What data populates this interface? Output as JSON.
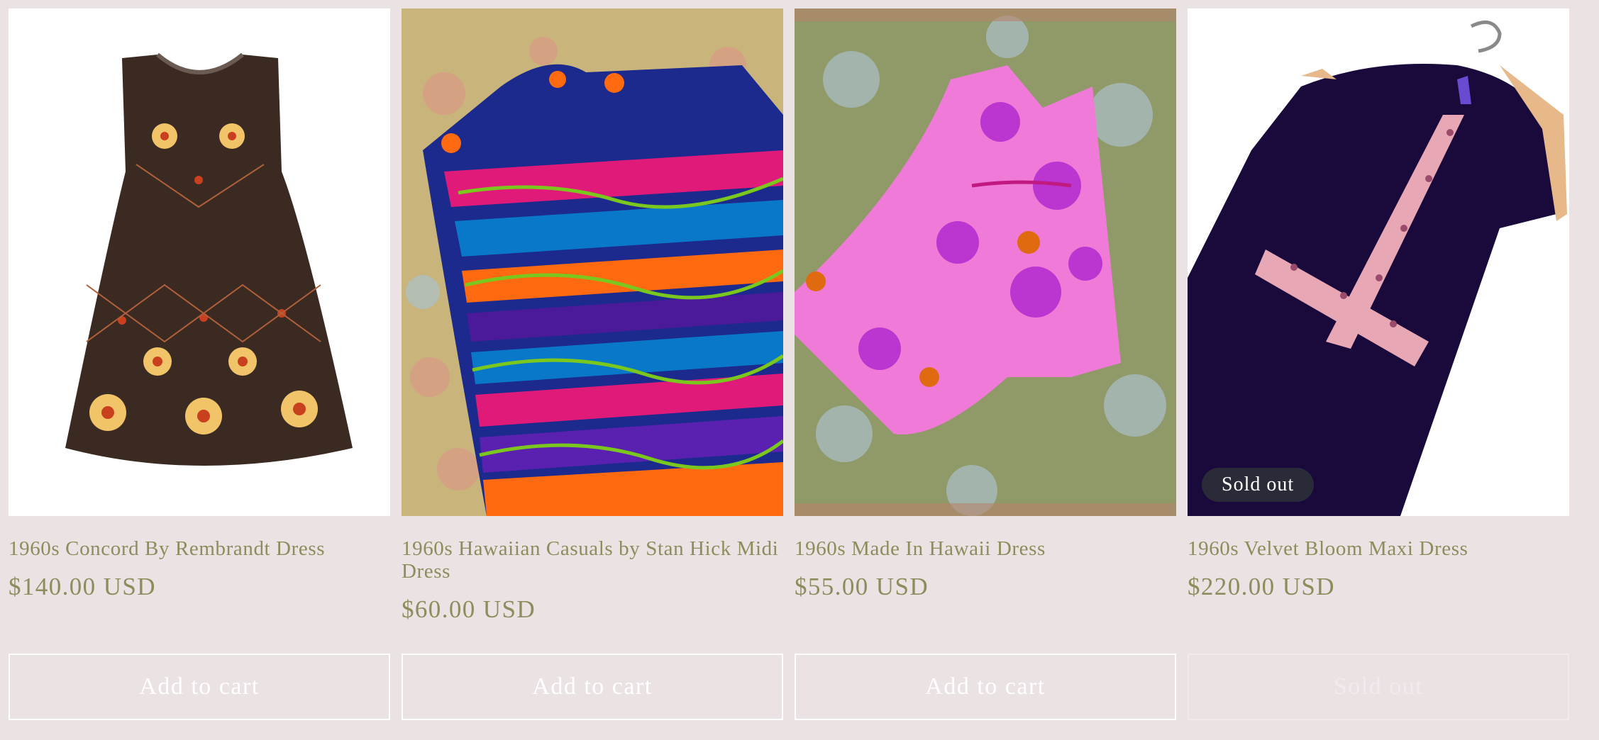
{
  "products": [
    {
      "title": "1960s Concord By Rembrandt Dress",
      "price": "$140.00 USD",
      "button_label": "Add to cart",
      "sold_out": false
    },
    {
      "title": "1960s Hawaiian Casuals by Stan Hick Midi Dress",
      "price": "$60.00 USD",
      "button_label": "Add to cart",
      "sold_out": false
    },
    {
      "title": "1960s Made In Hawaii Dress",
      "price": "$55.00 USD",
      "button_label": "Add to cart",
      "sold_out": false
    },
    {
      "title": "1960s Velvet Bloom Maxi Dress",
      "price": "$220.00 USD",
      "button_label": "Sold out",
      "badge": "Sold out",
      "sold_out": true
    }
  ],
  "colors": {
    "page_background": "#ebe2e4",
    "text": "#8c8c5c",
    "badge_background": "#2a2b38",
    "button_border": "#ffffff"
  }
}
